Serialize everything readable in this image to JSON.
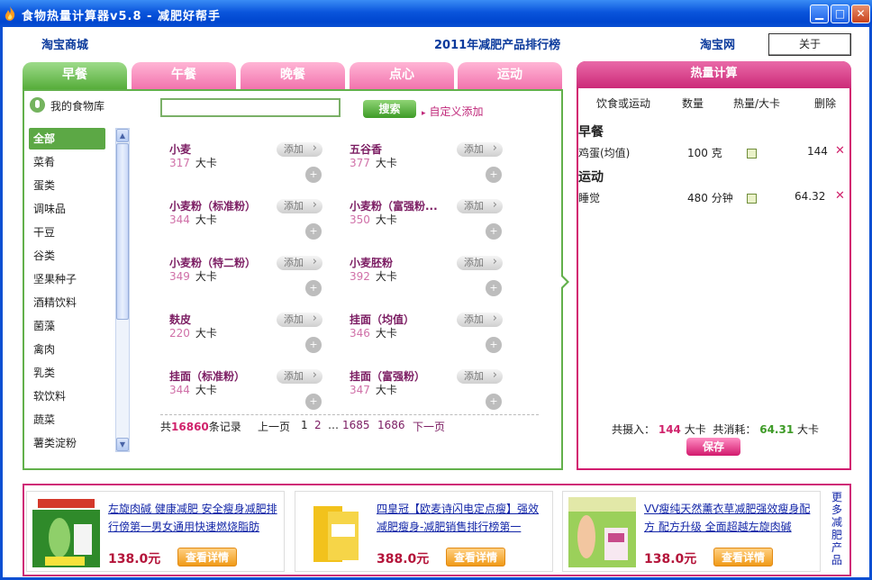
{
  "window": {
    "title": "食物热量计算器v5.8 - 减肥好帮手",
    "buttons": [
      "minimize",
      "maximize",
      "close"
    ]
  },
  "header": {
    "left_link": "淘宝商城",
    "center_link": "2011年减肥产品排行榜",
    "right_link": "淘宝网",
    "about_label": "关于"
  },
  "tabs": [
    {
      "label": "早餐",
      "active": true
    },
    {
      "label": "午餐"
    },
    {
      "label": "晚餐"
    },
    {
      "label": "点心"
    },
    {
      "label": "运动"
    }
  ],
  "library": {
    "title": "我的食物库",
    "search_value": "",
    "search_label": "搜索",
    "custom_add": "自定义添加",
    "categories": [
      "全部",
      "菜肴",
      "蛋类",
      "调味品",
      "干豆",
      "谷类",
      "坚果种子",
      "酒精饮料",
      "菌藻",
      "禽肉",
      "乳类",
      "软饮料",
      "蔬菜",
      "薯类淀粉"
    ],
    "add_label": "添加",
    "unit": "大卡",
    "foods": [
      {
        "name": "小麦",
        "cal": "317"
      },
      {
        "name": "五谷香",
        "cal": "377"
      },
      {
        "name": "小麦粉（标准粉）",
        "cal": "344"
      },
      {
        "name": "小麦粉（富强粉...",
        "cal": "350"
      },
      {
        "name": "小麦粉（特二粉）",
        "cal": "349"
      },
      {
        "name": "小麦胚粉",
        "cal": "392"
      },
      {
        "name": "麸皮",
        "cal": "220"
      },
      {
        "name": "挂面（均值）",
        "cal": "346"
      },
      {
        "name": "挂面（标准粉）",
        "cal": "344"
      },
      {
        "name": "挂面（富强粉）",
        "cal": "347"
      }
    ],
    "pager": {
      "prefix": "共",
      "count": "16860",
      "suffix": "条记录",
      "prev": "上一页",
      "pages": [
        "1",
        "2",
        "…",
        "1685",
        "1686"
      ],
      "next": "下一页"
    }
  },
  "calc": {
    "title": "热量计算",
    "cols": [
      "饮食或运动",
      "数量",
      "热量/大卡",
      "删除"
    ],
    "sections": [
      {
        "name": "早餐",
        "rows": [
          {
            "item": "鸡蛋(均值)",
            "qty": "100 克",
            "kcal": "144"
          }
        ]
      },
      {
        "name": "运动",
        "rows": [
          {
            "item": "睡觉",
            "qty": "480 分钟",
            "kcal": "64.32"
          }
        ]
      }
    ],
    "intake_label": "共摄入：",
    "intake": "144",
    "unit": "大卡",
    "burn_label": "共消耗：",
    "burn": "64.31",
    "save_label": "保存"
  },
  "ads": [
    {
      "text": "左旋肉碱 健康减肥 安全瘦身减肥排行傍第一男女通用快速燃烧脂肪",
      "price": "138.0元",
      "detail": "查看详情"
    },
    {
      "text": "四皇冠【欧麦诗闪电定点瘦】强效减肥瘦身-减肥销售排行榜第一",
      "price": "388.0元",
      "detail": "查看详情"
    },
    {
      "text": "VV瘦纯天然薰衣草减肥强效瘦身配方 配方升级 全面超越左旋肉碱",
      "price": "138.0元",
      "detail": "查看详情"
    }
  ],
  "more_label": "更多减肥产品",
  "colors": {
    "accent_green": "#5ca845",
    "accent_pink": "#d21c6f",
    "title_blue": "#0a55dc"
  }
}
